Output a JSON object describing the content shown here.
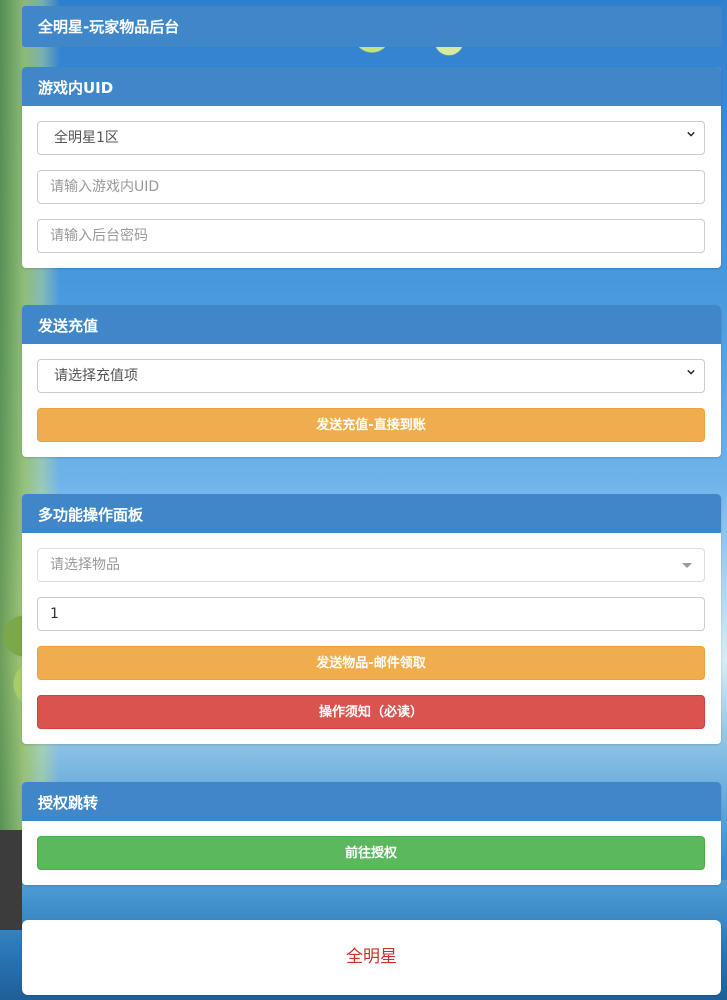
{
  "header": {
    "title": "全明星-玩家物品后台"
  },
  "panels": {
    "uid": {
      "title": "游戏内UID",
      "server_selected": "全明星1区",
      "uid_placeholder": "请输入游戏内UID",
      "password_placeholder": "请输入后台密码"
    },
    "recharge": {
      "title": "发送充值",
      "recharge_selected": "请选择充值项",
      "send_button": "发送充值-直接到账"
    },
    "multi": {
      "title": "多功能操作面板",
      "item_placeholder": "请选择物品",
      "quantity_value": "1",
      "send_item_button": "发送物品-邮件领取",
      "notice_button": "操作须知（必读）"
    },
    "auth": {
      "title": "授权跳转",
      "goto_button": "前往授权"
    }
  },
  "footer": {
    "text": "全明星"
  },
  "colors": {
    "primary": "#3f87c9",
    "warning": "#f0ad4e",
    "danger": "#d9534f",
    "success": "#5cb85c",
    "footer_text": "#c9302c"
  },
  "icons": {
    "select_arrow": "chevron-down-icon",
    "dropdown_caret": "caret-down-icon"
  }
}
